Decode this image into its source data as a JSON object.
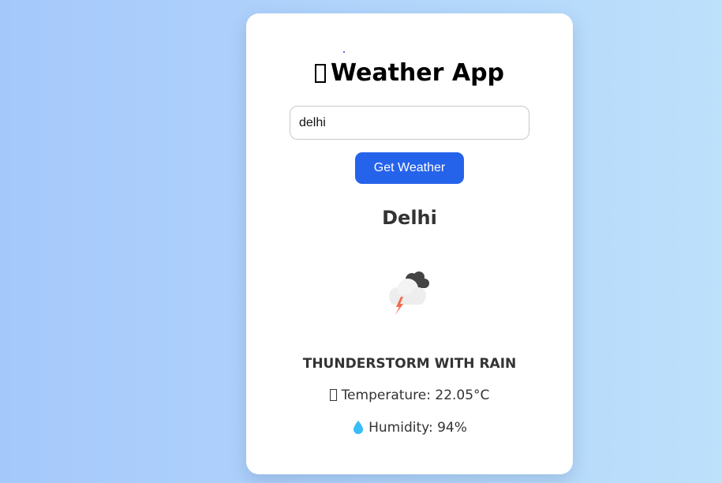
{
  "header": {
    "title": "Weather App",
    "title_icon": "missing-glyph-icon"
  },
  "search": {
    "value": "delhi",
    "placeholder": ""
  },
  "actions": {
    "get_weather_label": "Get Weather"
  },
  "result": {
    "city": "Delhi",
    "condition_icon": "thunderstorm-rain-icon",
    "condition": "THUNDERSTORM WITH RAIN",
    "temperature_label": "Temperature:",
    "temperature_value": "22.05°C",
    "temperature_icon": "missing-glyph-icon",
    "humidity_label": "Humidity:",
    "humidity_value": "94%",
    "humidity_icon": "water-drop-icon"
  },
  "colors": {
    "background_start": "#a5c8fb",
    "background_end": "#bde0fb",
    "card": "#ffffff",
    "button": "#2563eb",
    "text": "#333333",
    "drop": "#38bdf8"
  }
}
